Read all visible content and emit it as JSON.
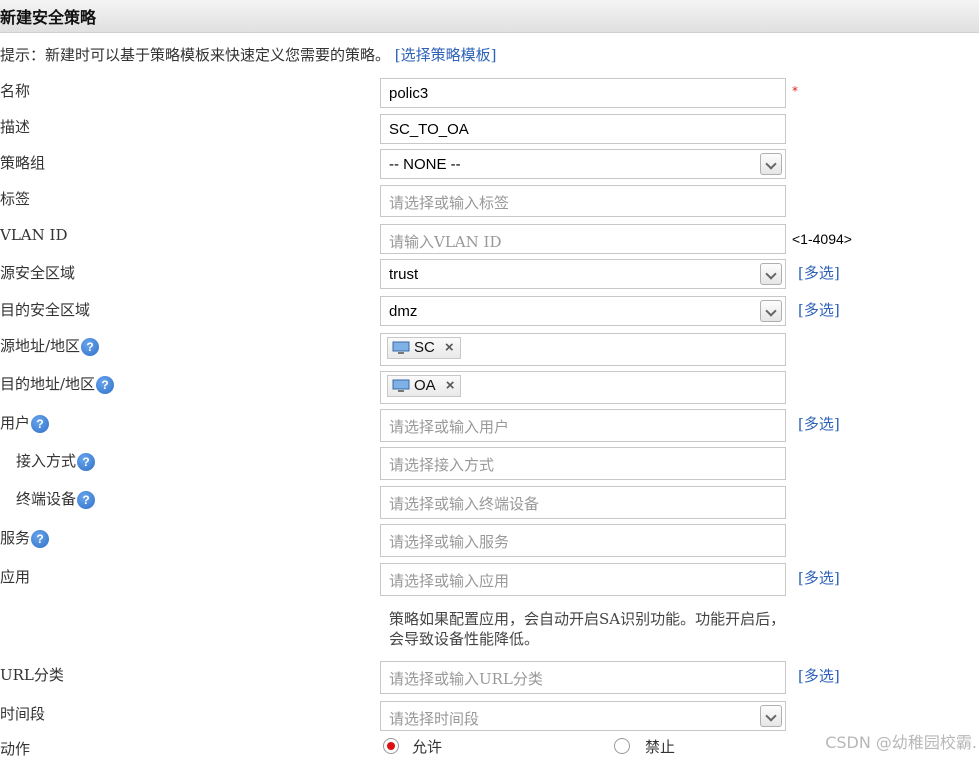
{
  "header": {
    "title": "新建安全策略"
  },
  "hint": {
    "text": "提示：新建时可以基于策略模板来快速定义您需要的策略。",
    "link": "[选择策略模板]"
  },
  "form": {
    "name": {
      "label": "名称",
      "value": "polic3",
      "required": "*"
    },
    "description": {
      "label": "描述",
      "value": "SC_TO_OA"
    },
    "policy_group": {
      "label": "策略组",
      "value": "-- NONE --"
    },
    "tag": {
      "label": "标签",
      "placeholder": "请选择或输入标签"
    },
    "vlan": {
      "label": "VLAN ID",
      "placeholder": "请输入VLAN ID",
      "range": "<1-4094>"
    },
    "src_zone": {
      "label": "源安全区域",
      "value": "trust",
      "multi": "[多选]"
    },
    "dst_zone": {
      "label": "目的安全区域",
      "value": "dmz",
      "multi": "[多选]"
    },
    "src_addr": {
      "label": "源地址/地区",
      "tag": "SC"
    },
    "dst_addr": {
      "label": "目的地址/地区",
      "tag": "OA"
    },
    "user": {
      "label": "用户",
      "placeholder": "请选择或输入用户",
      "multi": "[多选]"
    },
    "access_mode": {
      "label": "接入方式",
      "placeholder": "请选择接入方式"
    },
    "terminal": {
      "label": "终端设备",
      "placeholder": "请选择或输入终端设备"
    },
    "service": {
      "label": "服务",
      "placeholder": "请选择或输入服务"
    },
    "application": {
      "label": "应用",
      "placeholder": "请选择或输入应用",
      "multi": "[多选]",
      "note": "策略如果配置应用，会自动开启SA识别功能。功能开启后，会导致设备性能降低。"
    },
    "url_category": {
      "label": "URL分类",
      "placeholder": "请选择或输入URL分类",
      "multi": "[多选]"
    },
    "time_range": {
      "label": "时间段",
      "placeholder": "请选择时间段"
    },
    "action": {
      "label": "动作",
      "permit": "允许",
      "deny": "禁止",
      "selected": "permit"
    }
  },
  "icons": {
    "help": "?",
    "remove": "×"
  },
  "watermark": "CSDN @幼稚园校霸.",
  "colors": {
    "link": "#2d62b8",
    "required": "#e02020",
    "radio_selected": "#dd1111"
  }
}
